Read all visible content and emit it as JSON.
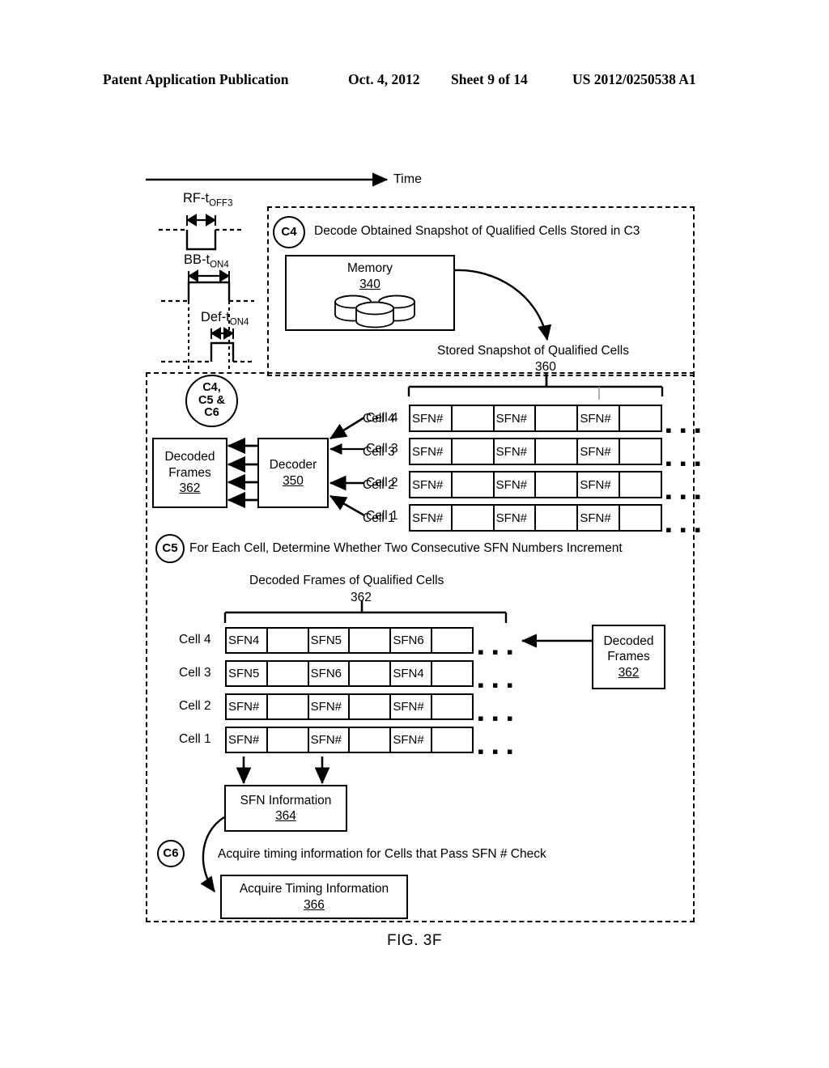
{
  "header": {
    "title": "Patent Application Publication",
    "date": "Oct. 4, 2012",
    "sheet": "Sheet 9 of 14",
    "pub_number": "US 2012/0250538 A1"
  },
  "figure": {
    "caption": "FIG. 3F",
    "time_axis_label": "Time"
  },
  "timing": {
    "waveforms": [
      {
        "label_main": "RF-t",
        "label_sub": "OFF3"
      },
      {
        "label_main": "BB-t",
        "label_sub": "ON4"
      },
      {
        "label_main": "Def-t",
        "label_sub": "ON4"
      }
    ]
  },
  "steps": {
    "c4": {
      "tag": "C4",
      "text": "Decode Obtained Snapshot of Qualified Cells Stored in C3"
    },
    "c456": {
      "line1": "C4,",
      "line2": "C5 &",
      "line3": "C6"
    },
    "c5": {
      "tag": "C5",
      "text": "For Each Cell, Determine Whether Two Consecutive SFN Numbers Increment"
    },
    "c6": {
      "tag": "C6",
      "text": "Acquire timing information for Cells that Pass SFN # Check"
    }
  },
  "blocks": {
    "memory": {
      "title": "Memory",
      "ref": "340"
    },
    "decoder": {
      "title": "Decoder",
      "ref": "350"
    },
    "decoded_frames_left": {
      "line1": "Decoded",
      "line2": "Frames",
      "ref": "362"
    },
    "decoded_frames_right": {
      "line1": "Decoded",
      "line2": "Frames",
      "ref": "362"
    },
    "sfn_information": {
      "title": "SFN Information",
      "ref": "364"
    },
    "acquire_timing": {
      "title": "Acquire Timing Information",
      "ref": "366"
    }
  },
  "stored_snapshot": {
    "title": "Stored Snapshot of Qualified Cells",
    "ref": "360",
    "ellipsis": "▪ ▪ ▪",
    "rows": [
      {
        "label": "Cell 4",
        "cells": [
          "SFN#",
          "",
          "SFN#",
          "",
          "SFN#",
          ""
        ]
      },
      {
        "label": "Cell 3",
        "cells": [
          "SFN#",
          "",
          "SFN#",
          "",
          "SFN#",
          ""
        ]
      },
      {
        "label": "Cell 2",
        "cells": [
          "SFN#",
          "",
          "SFN#",
          "",
          "SFN#",
          ""
        ]
      },
      {
        "label": "Cell 1",
        "cells": [
          "SFN#",
          "",
          "SFN#",
          "",
          "SFN#",
          ""
        ]
      }
    ]
  },
  "decoder_inputs": [
    {
      "label": "Cell 4"
    },
    {
      "label": "Cell 3"
    },
    {
      "label": "Cell 2"
    },
    {
      "label": "Cell 1"
    }
  ],
  "decoded_frames_table": {
    "title": "Decoded Frames of Qualified Cells",
    "ref": "362",
    "ellipsis": "▪ ▪ ▪",
    "rows": [
      {
        "label": "Cell 4",
        "cells": [
          "SFN4",
          "",
          "SFN5",
          "",
          "SFN6",
          ""
        ]
      },
      {
        "label": "Cell 3",
        "cells": [
          "SFN5",
          "",
          "SFN6",
          "",
          "SFN4",
          ""
        ]
      },
      {
        "label": "Cell 2",
        "cells": [
          "SFN#",
          "",
          "SFN#",
          "",
          "SFN#",
          ""
        ]
      },
      {
        "label": "Cell 1",
        "cells": [
          "SFN#",
          "",
          "SFN#",
          "",
          "SFN#",
          ""
        ]
      }
    ]
  },
  "colors": {
    "ink": "#000000",
    "paper": "#ffffff"
  }
}
